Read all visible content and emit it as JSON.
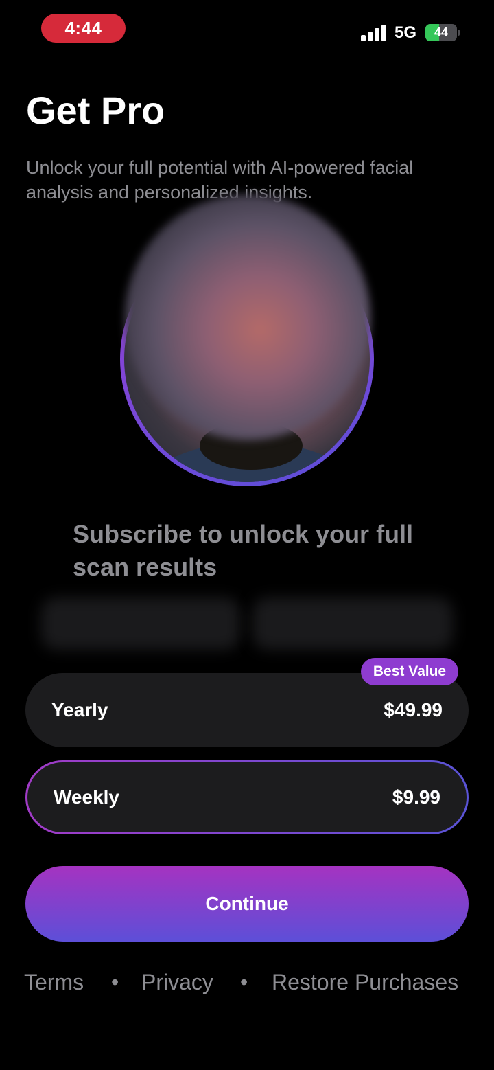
{
  "status_bar": {
    "time": "4:44",
    "network": "5G",
    "battery": "44",
    "battery_level": 0.44
  },
  "header": {
    "title": "Get Pro",
    "subtitle": "Unlock your full potential with AI-powered facial analysis and personalized insights."
  },
  "main": {
    "subscribe_heading": "Subscribe to unlock your full scan results"
  },
  "plans": [
    {
      "name": "Yearly",
      "price": "$49.99",
      "badge": "Best Value",
      "selected": false
    },
    {
      "name": "Weekly",
      "price": "$9.99",
      "selected": true
    }
  ],
  "cta": {
    "label": "Continue"
  },
  "footer": {
    "terms": "Terms",
    "separator": "•",
    "privacy": "Privacy",
    "restore": "Restore Purchases"
  },
  "colors": {
    "accent_purple": "#9b3fd6",
    "accent_indigo": "#5a4fd8",
    "time_pill": "#d62a3a",
    "battery_green": "#35c759"
  }
}
